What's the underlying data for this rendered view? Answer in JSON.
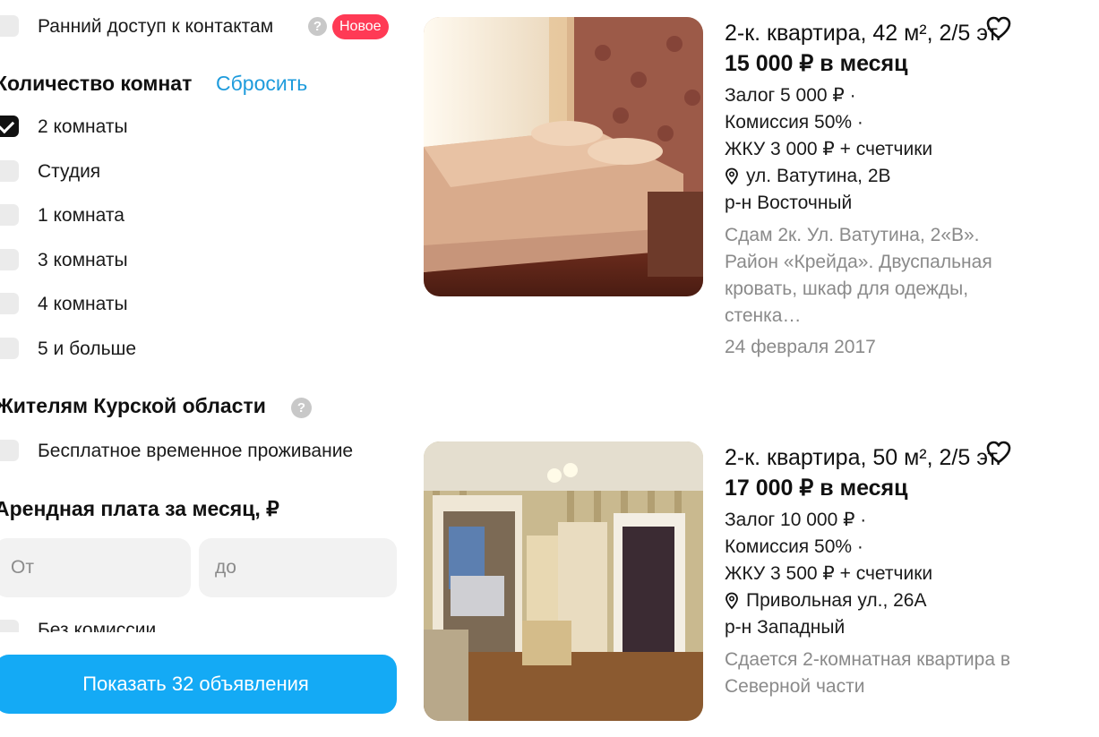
{
  "filters": {
    "early_access": {
      "label": "Ранний доступ к контактам",
      "badge": "Новое"
    },
    "rooms": {
      "title": "Количество комнат",
      "reset_label": "Сбросить",
      "options": [
        {
          "label": "2 комнаты",
          "checked": true
        },
        {
          "label": "Студия",
          "checked": false
        },
        {
          "label": "1 комната",
          "checked": false
        },
        {
          "label": "3 комнаты",
          "checked": false
        },
        {
          "label": "4 комнаты",
          "checked": false
        },
        {
          "label": "5 и больше",
          "checked": false
        }
      ]
    },
    "kursk": {
      "title": "Жителям Курской области",
      "option": {
        "label": "Бесплатное временное проживание",
        "checked": false
      }
    },
    "rent": {
      "title": "Арендная плата за месяц, ₽",
      "from_placeholder": "От",
      "to_placeholder": "до",
      "no_commission_label": "Без комиссии"
    },
    "show_button_label": "Показать 32 объявления"
  },
  "listings": [
    {
      "title": "2-к. квартира, 42 м², 2/5 эт.",
      "price": "15 000 ₽ в месяц",
      "deposit": "Залог 5 000 ₽ ·",
      "commission": "Комиссия 50% ·",
      "utilities": "ЖКУ 3 000 ₽ + счетчики",
      "address": "ул. Ватутина, 2В",
      "district": "р-н Восточный",
      "description": "Сдам 2к. Ул. Ватутина, 2«В». Район «Крейда». Двуспальная кровать, шкаф для одежды, стенка…",
      "date": "24 февраля 2017"
    },
    {
      "title": "2-к. квартира, 50 м², 2/5 эт.",
      "price": "17 000 ₽ в месяц",
      "deposit": "Залог 10 000 ₽ ·",
      "commission": "Комиссия 50% ·",
      "utilities": "ЖКУ 3 500 ₽ + счетчики",
      "address": "Привольная ул., 26А",
      "district": "р-н Западный",
      "description": "Сдается 2-комнатная квартира в Северной части"
    }
  ]
}
